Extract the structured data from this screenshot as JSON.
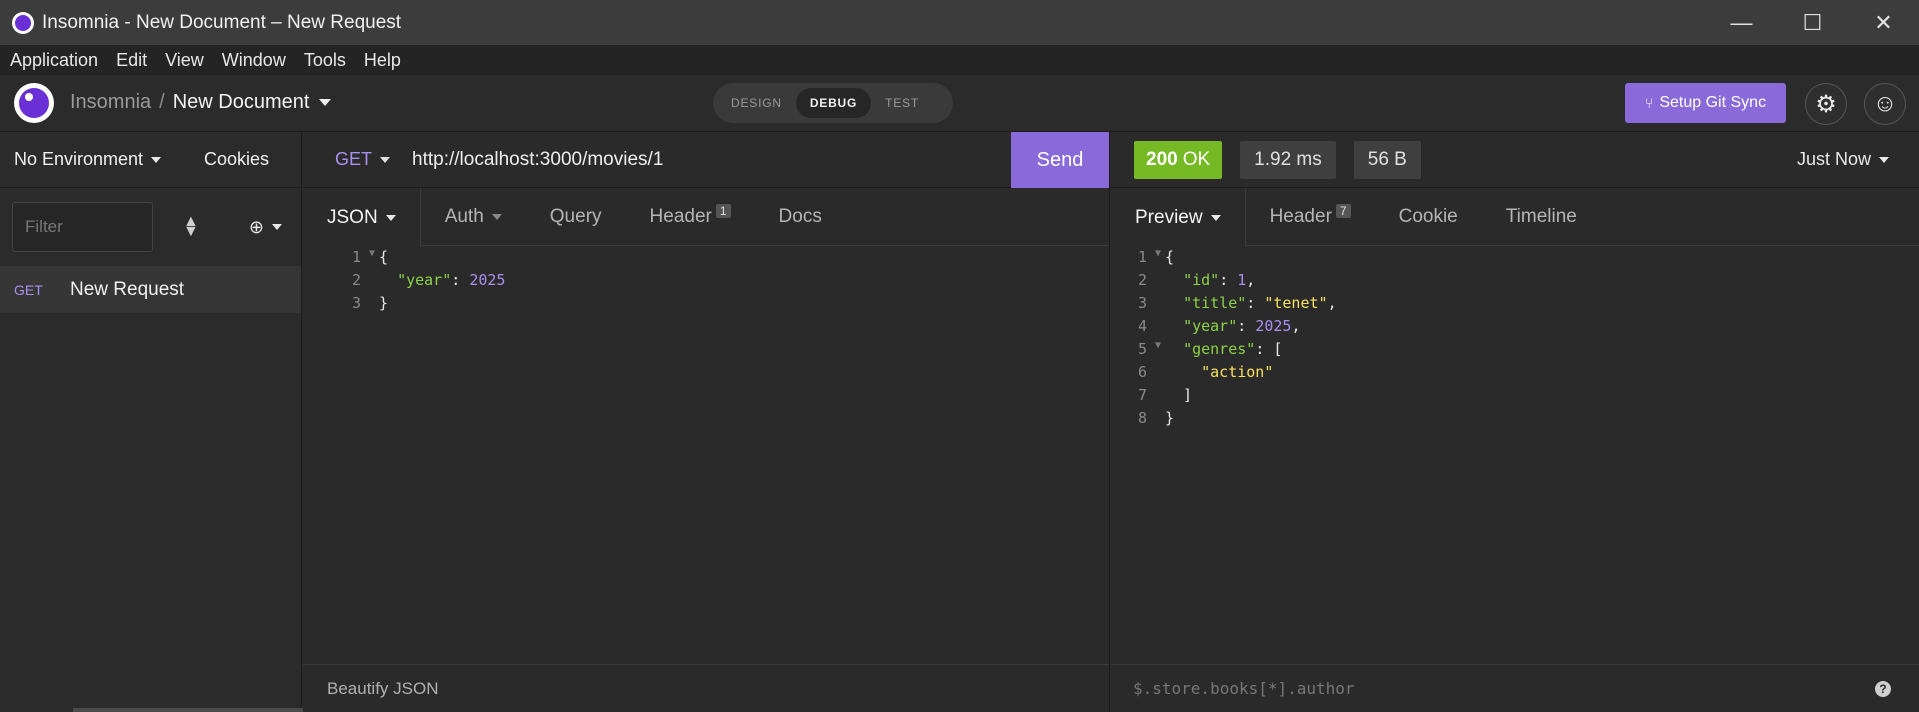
{
  "window": {
    "title": "Insomnia - New Document – New Request",
    "minimize": "—",
    "maximize": "☐",
    "close": "✕"
  },
  "menu": [
    "Application",
    "Edit",
    "View",
    "Window",
    "Tools",
    "Help"
  ],
  "header": {
    "workspace": "Insomnia",
    "separator": "/",
    "document": "New Document",
    "modes": [
      "DESIGN",
      "DEBUG",
      "TEST"
    ],
    "active_mode": "DEBUG",
    "git_sync_label": "Setup Git Sync",
    "settings_icon": "⚙",
    "account_icon": "☺"
  },
  "sidebar": {
    "environment": "No Environment",
    "cookies": "Cookies",
    "filter_placeholder": "Filter",
    "requests": [
      {
        "method": "GET",
        "name": "New Request"
      }
    ]
  },
  "request": {
    "method": "GET",
    "url": "http://localhost:3000/movies/1",
    "send_label": "Send",
    "tabs": [
      {
        "label": "JSON",
        "badge": ""
      },
      {
        "label": "Auth",
        "badge": ""
      },
      {
        "label": "Query",
        "badge": ""
      },
      {
        "label": "Header",
        "badge": "1"
      },
      {
        "label": "Docs",
        "badge": ""
      }
    ],
    "body_lines": [
      "1",
      "2",
      "3"
    ],
    "body": {
      "open": "{",
      "key": "\"year\"",
      "colon": ": ",
      "value": "2025",
      "close": "}"
    },
    "footer": "Beautify JSON"
  },
  "response": {
    "status_code": "200",
    "status_text": "OK",
    "time": "1.92 ms",
    "size": "56 B",
    "timestamp": "Just Now",
    "tabs": [
      {
        "label": "Preview",
        "badge": ""
      },
      {
        "label": "Header",
        "badge": "7"
      },
      {
        "label": "Cookie",
        "badge": ""
      },
      {
        "label": "Timeline",
        "badge": ""
      }
    ],
    "lines": [
      "1",
      "2",
      "3",
      "4",
      "5",
      "6",
      "7",
      "8"
    ],
    "json": {
      "id_key": "\"id\"",
      "id_val": "1",
      "title_key": "\"title\"",
      "title_val": "\"tenet\"",
      "year_key": "\"year\"",
      "year_val": "2025",
      "genres_key": "\"genres\"",
      "genre_0": "\"action\""
    },
    "query_placeholder": "$.store.books[*].author",
    "help_icon": "?"
  },
  "colors": {
    "accent": "#8a6ad9",
    "status_ok": "#75ba24",
    "json_key": "#8bd246",
    "json_number": "#a890f0",
    "json_string": "#f6e05e"
  }
}
